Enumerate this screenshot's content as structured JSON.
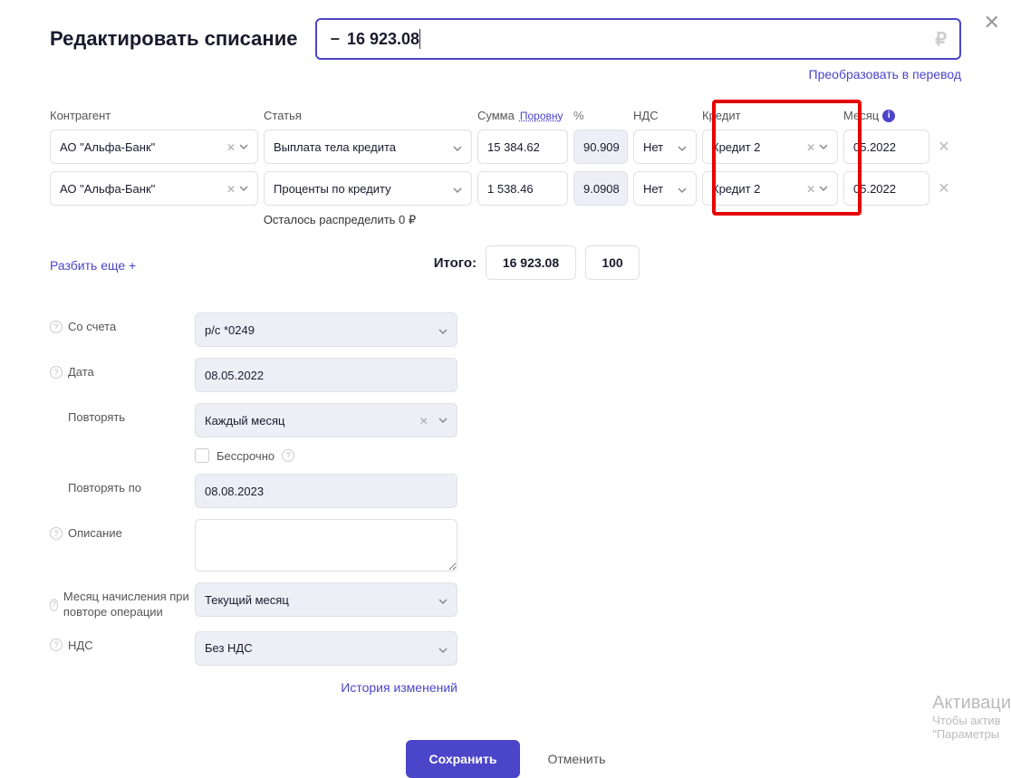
{
  "page_title": "Редактировать списание",
  "amount_sign": "−",
  "amount_value": "16 923.08",
  "currency_symbol": "₽",
  "convert_link": "Преобразовать в перевод",
  "headers": {
    "counterparty": "Контрагент",
    "article": "Статья",
    "sum": "Сумма",
    "evenly_link": "Поровну",
    "percent": "%",
    "vat": "НДС",
    "credit": "Кредит",
    "month": "Месяц"
  },
  "rows": [
    {
      "counterparty": "АО \"Альфа-Банк\"",
      "article": "Выплата тела кредита",
      "sum": "15 384.62",
      "percent": "90.909",
      "vat": "Нет",
      "credit": "Кредит 2",
      "month": "05.2022"
    },
    {
      "counterparty": "АО \"Альфа-Банк\"",
      "article": "Проценты по кредиту",
      "sum": "1 538.46",
      "percent": "9.0908",
      "vat": "Нет",
      "credit": "Кредит 2",
      "month": "05.2022"
    }
  ],
  "remaining_text": "Осталось распределить 0 ₽",
  "split_more": "Разбить еще +",
  "total_label": "Итого:",
  "total_sum": "16 923.08",
  "total_percent": "100",
  "form": {
    "account_label": "Со счета",
    "account_value": "р/с *0249",
    "date_label": "Дата",
    "date_value": "08.05.2022",
    "repeat_label": "Повторять",
    "repeat_value": "Каждый месяц",
    "infinite_label": "Бессрочно",
    "repeat_until_label": "Повторять по",
    "repeat_until_value": "08.08.2023",
    "description_label": "Описание",
    "accrual_month_label": "Месяц начисления при повторе операции",
    "accrual_month_value": "Текущий месяц",
    "vat_label": "НДС",
    "vat_value": "Без НДС"
  },
  "history_link": "История изменений",
  "save_btn": "Сохранить",
  "cancel_btn": "Отменить",
  "watermark": {
    "title": "Активаци",
    "line1": "Чтобы актив",
    "line2": "\"Параметры"
  }
}
